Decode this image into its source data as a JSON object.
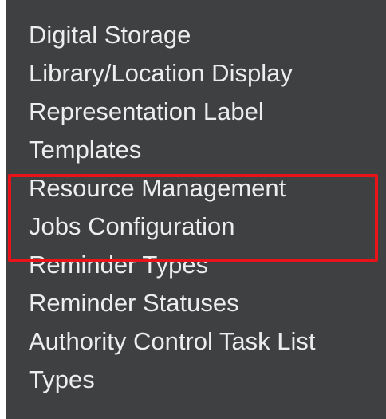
{
  "menu": {
    "items": [
      {
        "lines": [
          "Digital Storage"
        ]
      },
      {
        "lines": [
          "Library/Location Display"
        ]
      },
      {
        "lines": [
          "Representation Label",
          "Templates"
        ]
      },
      {
        "lines": [
          "Resource Management",
          "Jobs Configuration"
        ],
        "highlighted": true
      },
      {
        "lines": [
          "Reminder Types"
        ]
      },
      {
        "lines": [
          "Reminder Statuses"
        ]
      },
      {
        "lines": [
          "Authority Control Task List",
          "Types"
        ]
      }
    ]
  },
  "colors": {
    "panel_background": "#3e4042",
    "text": "#eceded",
    "highlight_border": "#e8141a"
  }
}
